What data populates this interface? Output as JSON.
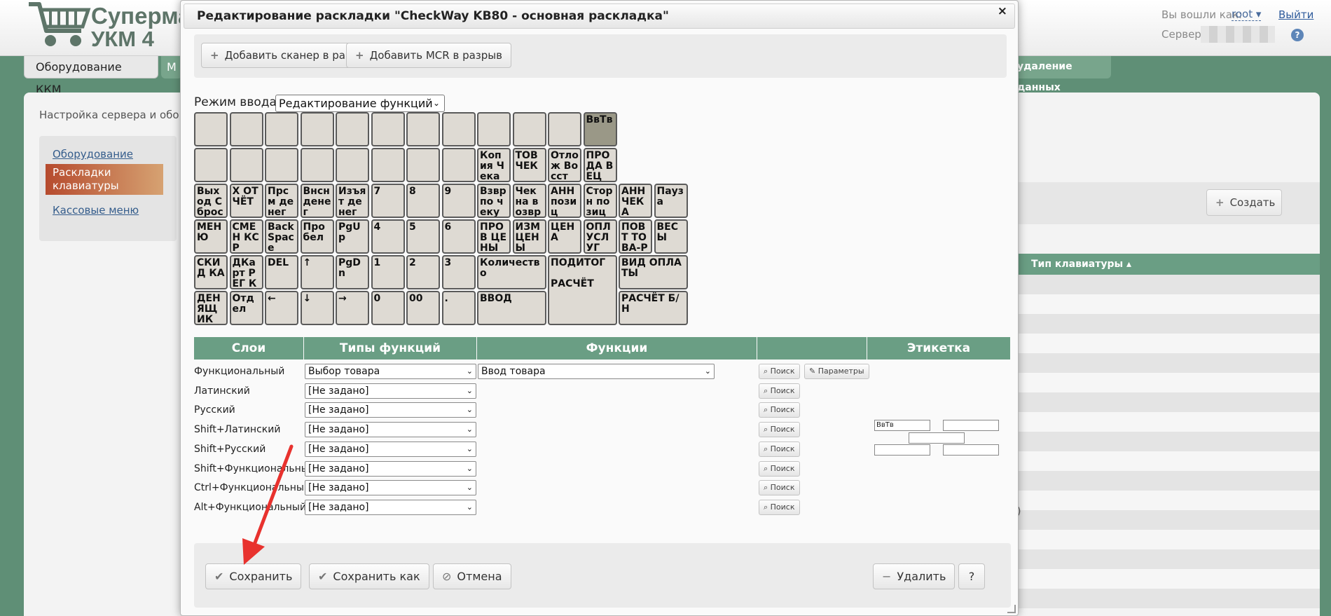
{
  "app": {
    "logo_line1": "Супермаг",
    "logo_line2": "УКМ 4",
    "logged_in_label": "Вы вошли как:",
    "user": "root ▾",
    "logout": "Выйти",
    "server_label": "Сервер:",
    "help": "?"
  },
  "nav": {
    "active_tab": "Оборудование ККМ",
    "dim_tab": "М",
    "right_tab": "удаление данных"
  },
  "page": {
    "breadcrumb": "Настройка сервера и обор",
    "side_items": [
      "Оборудование",
      "Раскладки клавиатуры",
      "Кассовые меню"
    ],
    "create_button": "Создать",
    "type_header": "Тип клавиатуры ▴",
    "partial_cell": ")"
  },
  "modal": {
    "title": "Редактирование раскладки \"CheckWay KB80 - основная раскладка\"",
    "close": "×",
    "add_scanner": "Добавить сканер в разрыв",
    "add_mcr": "Добавить MCR в разрыв",
    "mode_label": "Режим ввода:",
    "mode_value": "Редактирование функций"
  },
  "keyboard": {
    "rows": [
      [
        "",
        "",
        "",
        "",
        "",
        "",
        "",
        "",
        "",
        "",
        "",
        "ВвТв",
        null,
        null
      ],
      [
        "",
        "",
        "",
        "",
        "",
        "",
        "",
        "",
        "Копия Чека",
        "ТОВ ЧЕК",
        "Отлож Восст Чек",
        "ПРО ДА ВЕЦ",
        null,
        null
      ],
      [
        "Выход Сброс",
        "X ОТЧЁТ",
        "Прсм денег",
        "Внсн денег",
        "Изъят денег",
        "7",
        "8",
        "9",
        "Взвр по чеку",
        "Чек на возвр",
        "АНН позиц",
        "Сторн позиц",
        "АНН ЧЕКА",
        "Пауза"
      ],
      [
        "МЕНЮ",
        "СМЕН КСР",
        "Back Space",
        "Про бел",
        "PgUp",
        "4",
        "5",
        "6",
        "ПРОВ ЦЕНЫ",
        "ИЗМ ЦЕНЫ",
        "ЦЕНА",
        "ОПЛ УСЛУГ",
        "ПОВТ ТОВА-РА",
        "ВЕСЫ"
      ],
      [
        "СКИД КА",
        "ДКарт РЕГ КЛНТ",
        "DEL",
        "↑",
        "PgDn",
        "1",
        "2",
        "3",
        "Количество",
        null,
        "ПОДИТОГ",
        null,
        "ВИД ОПЛАТЫ",
        null
      ],
      [
        "ДЕН ЯЩИК",
        "Отдел",
        "←",
        "↓",
        "→",
        "0",
        "00",
        ".",
        "ВВОД",
        null,
        "РАСЧЁТ",
        null,
        "РАСЧЁТ Б/Н",
        null
      ]
    ],
    "selected_key": "ВвТв"
  },
  "functions_table": {
    "headers": [
      "Слои",
      "Типы функций",
      "Функции",
      "",
      "Этикетка"
    ],
    "rows": [
      {
        "layer": "Функциональный",
        "type": "Выбор товара",
        "func": "Ввод товара"
      },
      {
        "layer": "Латинский",
        "type": "[Не задано]"
      },
      {
        "layer": "Русский",
        "type": "[Не задано]"
      },
      {
        "layer": "Shift+Латинский",
        "type": "[Не задано]"
      },
      {
        "layer": "Shift+Русский",
        "type": "[Не задано]"
      },
      {
        "layer": "Shift+Функциональный",
        "type": "[Не задано]"
      },
      {
        "layer": "Ctrl+Функциональный",
        "type": "[Не задано]"
      },
      {
        "layer": "Alt+Функциональный",
        "type": "[Не задано]"
      }
    ],
    "search_label": "Поиск",
    "params_label": "Параметры",
    "label_value": "ВвТв"
  },
  "footer": {
    "save": "Сохранить",
    "save_as": "Сохранить как",
    "cancel": "Отмена",
    "delete": "Удалить",
    "help": "?"
  },
  "colors": {
    "accent_green": "#6a9e84",
    "annotation_red": "#e8322e"
  }
}
